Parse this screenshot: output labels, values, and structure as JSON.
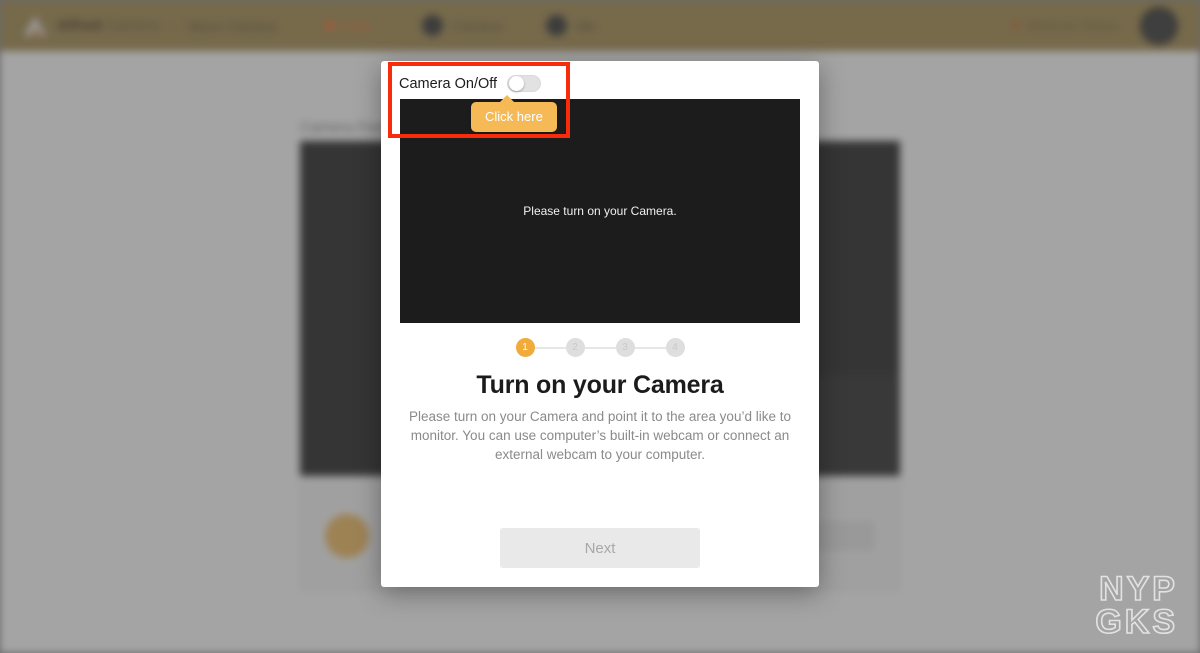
{
  "background_app": {
    "topbar": {
      "logo_icon": "alfred-triangle-logo",
      "brand_strong": "Alfred",
      "brand_light": "Camera",
      "separator": "-",
      "nav_items": [
        {
          "label": "Wyze Camera",
          "accent": false,
          "icon": null
        },
        {
          "label": "Live",
          "accent": true,
          "icon": "record-dot-icon"
        },
        {
          "label": "Camera",
          "accent": false,
          "icon": "camera-circle-icon"
        },
        {
          "label": "Me",
          "accent": false,
          "icon": "user-circle-icon"
        }
      ],
      "right_label": "Webcam Status",
      "avatar": "user-avatar"
    },
    "page_title": "Camera Feed",
    "card": {
      "icon": "shield-badge-icon",
      "button_label": "Upgrade"
    }
  },
  "modal": {
    "camera_toggle": {
      "label": "Camera On/Off",
      "state": "off"
    },
    "tooltip": {
      "text": "Click here",
      "color": "#f5b955"
    },
    "video": {
      "message": "Please turn on your Camera.",
      "background": "#1c1c1c"
    },
    "stepper": {
      "steps": [
        "1",
        "2",
        "3",
        "4"
      ],
      "active_index": 0,
      "active_color": "#f0ab3b",
      "inactive_color": "#dedede"
    },
    "title": "Turn on your Camera",
    "description": "Please turn on your Camera and point it to the area you’d like to monitor. You can use computer’s built-in webcam or connect an external webcam to your computer.",
    "next_button": {
      "label": "Next",
      "disabled": true
    }
  },
  "annotation": {
    "highlight_color": "#f72c0a"
  },
  "watermark": {
    "line1": "NYP",
    "line2": "GKS"
  }
}
